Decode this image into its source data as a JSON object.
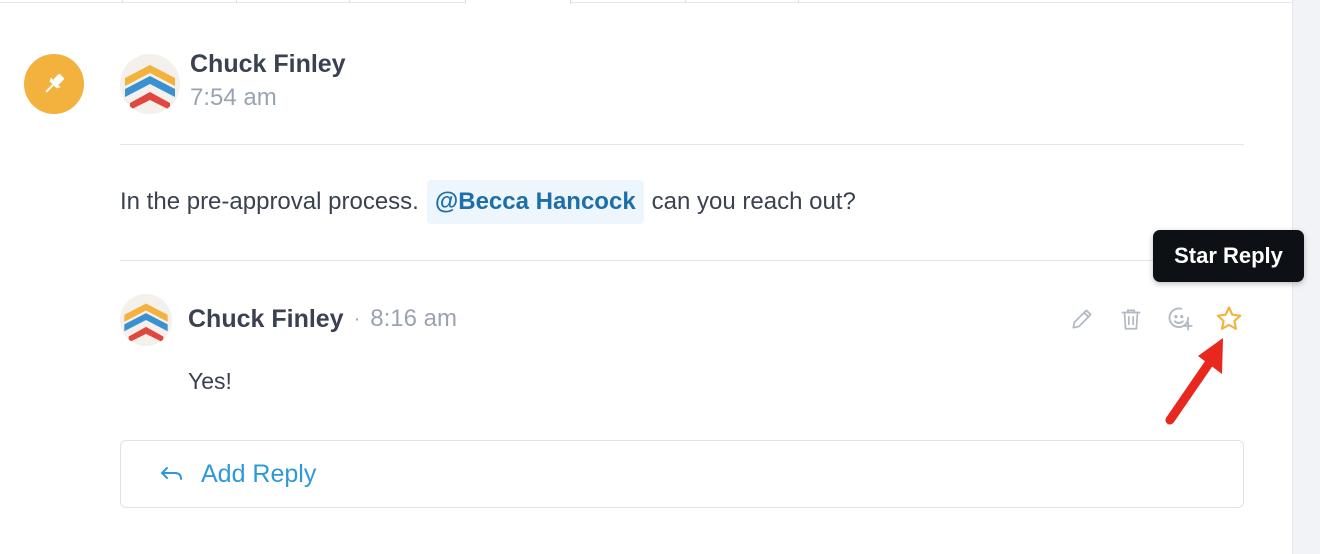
{
  "post": {
    "author": "Chuck Finley",
    "time": "7:54 am",
    "message_before": "In the pre-approval process.",
    "mention": "@Becca Hancock",
    "message_after": "can you reach out?"
  },
  "reply": {
    "author": "Chuck Finley",
    "separator": "·",
    "time": "8:16 am",
    "text": "Yes!"
  },
  "actions": {
    "icons": [
      "pencil-icon",
      "trash-icon",
      "emoji-add-icon",
      "star-icon"
    ]
  },
  "tooltip": {
    "label": "Star Reply"
  },
  "add_reply": {
    "label": "Add Reply"
  },
  "colors": {
    "pin_badge": "#f3b23e",
    "mention_bg": "#eef6fd",
    "mention_text": "#1e6fa8",
    "link": "#2d9ad8",
    "star": "#f3b23e",
    "annotation_arrow": "#e8281e"
  }
}
